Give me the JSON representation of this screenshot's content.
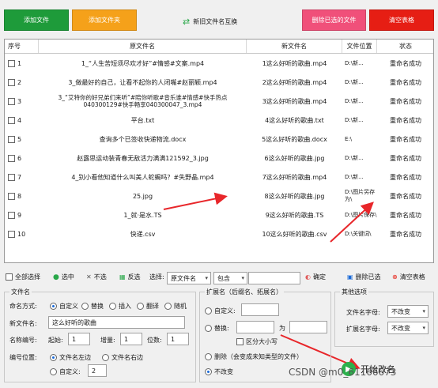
{
  "toolbar": {
    "add_file": "添加文件",
    "add_folder": "添加文件夹",
    "swap_names": "新旧文件名互换",
    "delete_selected": "删除已选的文件",
    "clear_table": "清空表格",
    "colors": {
      "green": "#1e9b3a",
      "orange": "#f5a11a",
      "pink": "#f0507a",
      "red": "#e61e14"
    }
  },
  "table": {
    "headers": [
      "序号",
      "原文件名",
      "新文件名",
      "文件位置",
      "状态"
    ],
    "rows": [
      {
        "no": "1",
        "original": "1_“人生苦短须尽欢才好”#情感#文案.mp4",
        "new": "1这么好听的歌曲.mp4",
        "location": "D:\\新...",
        "status": "重命名成功"
      },
      {
        "no": "2",
        "original": "3_做最好的自己，让看不起你的人闭嘴#赵丽颖.mp4",
        "new": "2这么好听的歌曲.mp4",
        "location": "D:\\新...",
        "status": "重命名成功"
      },
      {
        "no": "3",
        "original": "3_“艾特你的好兄弟们来听”#陪你听歌#音乐谁#情感#快手热点040300129#快手畅享040300047_3.mp4",
        "new": "3这么好听的歌曲.mp4",
        "location": "D:\\新...",
        "status": "重命名成功"
      },
      {
        "no": "4",
        "original": "平台.txt",
        "new": "4这么好听的歌曲.txt",
        "location": "D:\\新...",
        "status": "重命名成功"
      },
      {
        "no": "5",
        "original": "查询多个已签收快递物流.docx",
        "new": "5这么好听的歌曲.docx",
        "location": "E:\\",
        "status": "重命名成功"
      },
      {
        "no": "6",
        "original": "赵露思运动装青春无敌活力满满121592_3.jpg",
        "new": "6这么好听的歌曲.jpg",
        "location": "D:\\新...",
        "status": "重命名成功"
      },
      {
        "no": "7",
        "original": "4_别小看他知道什么叫美人蛇蝎吗？#失野晶.mp4",
        "new": "7这么好听的歌曲.mp4",
        "location": "D:\\新...",
        "status": "重命名成功"
      },
      {
        "no": "8",
        "original": "25.jpg",
        "new": "8这么好听的歌曲.jpg",
        "location": "D:\\图片另存为\\",
        "status": "重命名成功"
      },
      {
        "no": "9",
        "original": "1_就·是水.TS",
        "new": "9这么好听的歌曲.TS",
        "location": "D:\\图片保存\\",
        "status": "重命名成功"
      },
      {
        "no": "10",
        "original": "快递.csv",
        "new": "10这么好听的歌曲.csv",
        "location": "D:\\关键词\\",
        "status": "重命名成功"
      }
    ]
  },
  "filter": {
    "select_all": "全部选择",
    "select_checked": "选中",
    "unselect": "不选",
    "invert": "反选",
    "select_label": "选择:",
    "field_value": "原文件名",
    "mode_value": "包含",
    "confirm": "确定",
    "delete_selected": "删除已选",
    "clear_table": "清空表格"
  },
  "filename_group": {
    "title": "文件名",
    "naming_label": "命名方式:",
    "naming_options": [
      "自定义",
      "替换",
      "插入",
      "翻译",
      "随机"
    ],
    "new_name_label": "新文件名:",
    "new_name_value": "这么好听的歌曲",
    "numbering_label": "名称编号:",
    "start_label": "起始:",
    "start_value": "1",
    "step_label": "增量:",
    "step_value": "1",
    "digits_label": "位数:",
    "digits_value": "1",
    "position_label": "编号位置:",
    "position_options": [
      "文件名左边",
      "文件名右边",
      "自定义:"
    ],
    "custom_pos_value": "2"
  },
  "ext_group": {
    "title": "扩展名（后缀名、拓展名）",
    "custom": "自定义:",
    "replace": "替换:",
    "to": "为",
    "case_sensitive": "区分大小写",
    "delete": "删除（会变成未知类型的文件）",
    "no_change": "不改变"
  },
  "other_group": {
    "title": "其他选项",
    "filename_case_label": "文件名字母:",
    "filename_case_value": "不改变",
    "ext_case_label": "扩展名字母:",
    "ext_case_value": "不改变"
  },
  "start_button": "开始改名",
  "watermark": "CSDN @m0_61166673"
}
